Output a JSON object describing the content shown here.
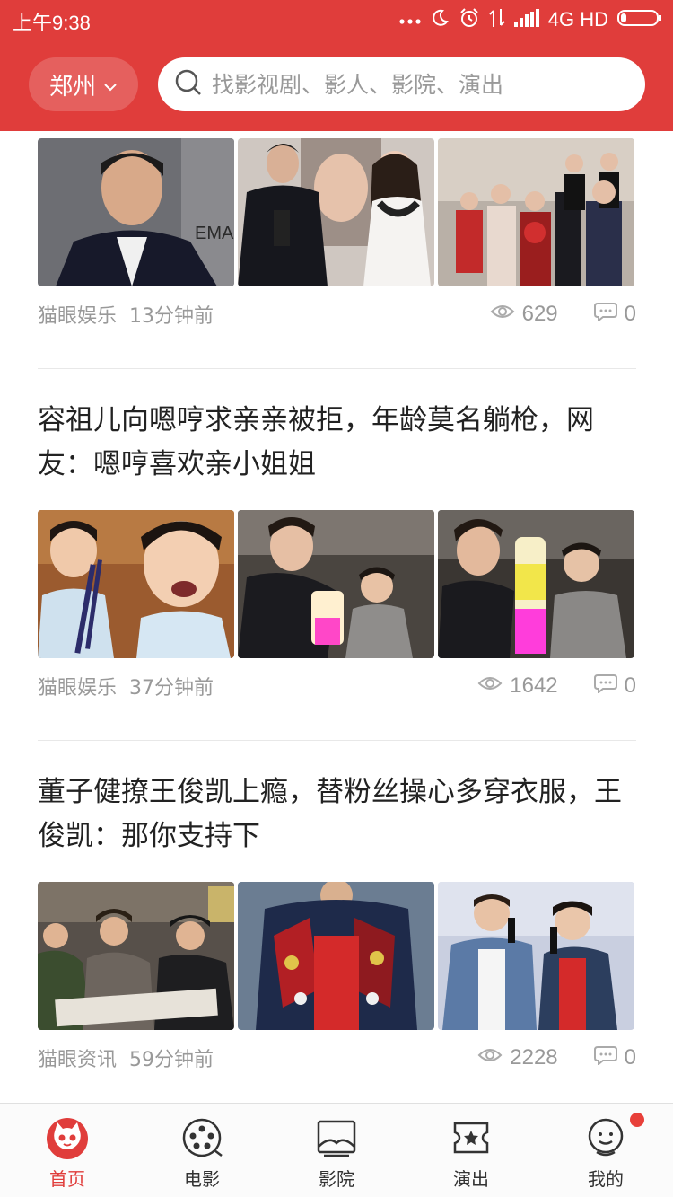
{
  "status_bar": {
    "time": "上午9:38",
    "network": "4G HD"
  },
  "header": {
    "city": "郑州",
    "search_placeholder": "找影视剧、影人、影院、演出"
  },
  "feed": [
    {
      "title": "",
      "source": "猫眼娱乐",
      "time": "13分钟前",
      "views": "629",
      "comments": "0"
    },
    {
      "title": "容祖儿向嗯哼求亲亲被拒，年龄莫名躺枪，网友：嗯哼喜欢亲小姐姐",
      "source": "猫眼娱乐",
      "time": "37分钟前",
      "views": "1642",
      "comments": "0"
    },
    {
      "title": "董子健撩王俊凯上瘾，替粉丝操心多穿衣服，王俊凯：那你支持下",
      "source": "猫眼资讯",
      "time": "59分钟前",
      "views": "2228",
      "comments": "0"
    }
  ],
  "tabbar": {
    "tabs": [
      {
        "label": "首页",
        "icon": "cat-home-icon",
        "active": true
      },
      {
        "label": "电影",
        "icon": "film-reel-icon",
        "active": false
      },
      {
        "label": "影院",
        "icon": "cinema-screen-icon",
        "active": false
      },
      {
        "label": "演出",
        "icon": "ticket-star-icon",
        "active": false
      },
      {
        "label": "我的",
        "icon": "profile-face-icon",
        "active": false
      }
    ]
  },
  "colors": {
    "brand": "#e03d3b",
    "badge": "#e8403a"
  }
}
